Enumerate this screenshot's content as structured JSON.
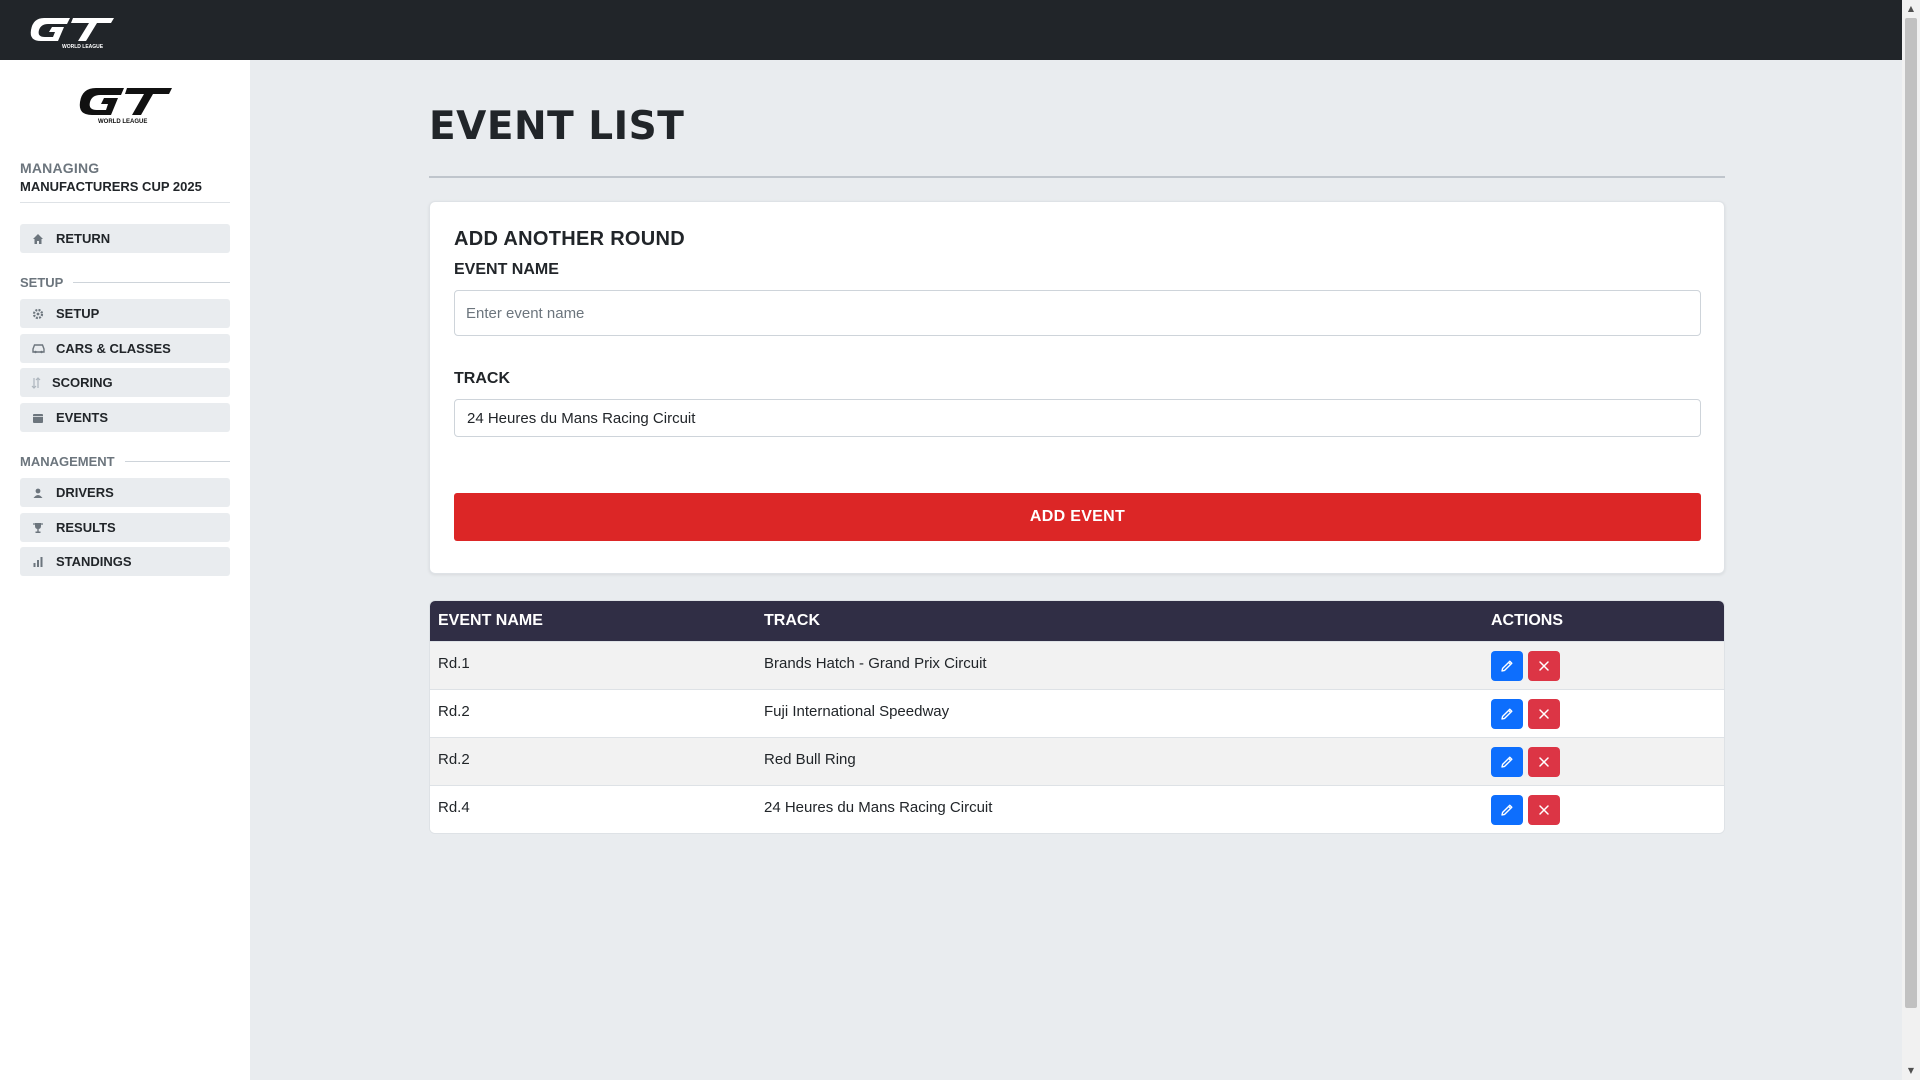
{
  "brand": {
    "logo_text": "GT",
    "logo_subtext": "WORLD LEAGUE"
  },
  "sidebar": {
    "managing_label": "MANAGING",
    "managing_value": "MANUFACTURERS CUP 2025",
    "return_item": {
      "label": "RETURN",
      "icon": "home-icon"
    },
    "setup_section": "SETUP",
    "setup_items": [
      {
        "label": "SETUP",
        "icon": "gear-icon"
      },
      {
        "label": "CARS & CLASSES",
        "icon": "car-icon"
      },
      {
        "label": "SCORING",
        "icon": "sort-icon"
      },
      {
        "label": "EVENTS",
        "icon": "calendar-icon"
      }
    ],
    "management_section": "MANAGEMENT",
    "management_items": [
      {
        "label": "DRIVERS",
        "icon": "user-icon"
      },
      {
        "label": "RESULTS",
        "icon": "trophy-icon"
      },
      {
        "label": "STANDINGS",
        "icon": "bar-chart-icon"
      }
    ]
  },
  "main": {
    "title": "EVENT LIST",
    "form": {
      "title": "ADD ANOTHER ROUND",
      "event_name_label": "EVENT NAME",
      "event_name_placeholder": "Enter event name",
      "event_name_value": "",
      "track_label": "TRACK",
      "track_value": "24 Heures du Mans Racing Circuit",
      "submit_label": "ADD EVENT"
    },
    "table": {
      "headers": [
        "EVENT NAME",
        "TRACK",
        "ACTIONS"
      ],
      "rows": [
        {
          "event": "Rd.1",
          "track": "Brands Hatch - Grand Prix Circuit"
        },
        {
          "event": "Rd.2",
          "track": "Fuji International Speedway"
        },
        {
          "event": "Rd.2",
          "track": "Red Bull Ring"
        },
        {
          "event": "Rd.4",
          "track": "24 Heures du Mans Racing Circuit"
        }
      ]
    }
  },
  "colors": {
    "topbar": "#212529",
    "accent_red": "#dc2626",
    "table_header": "#302e45",
    "edit_button": "#0d6efd",
    "delete_button": "#dc3545"
  }
}
